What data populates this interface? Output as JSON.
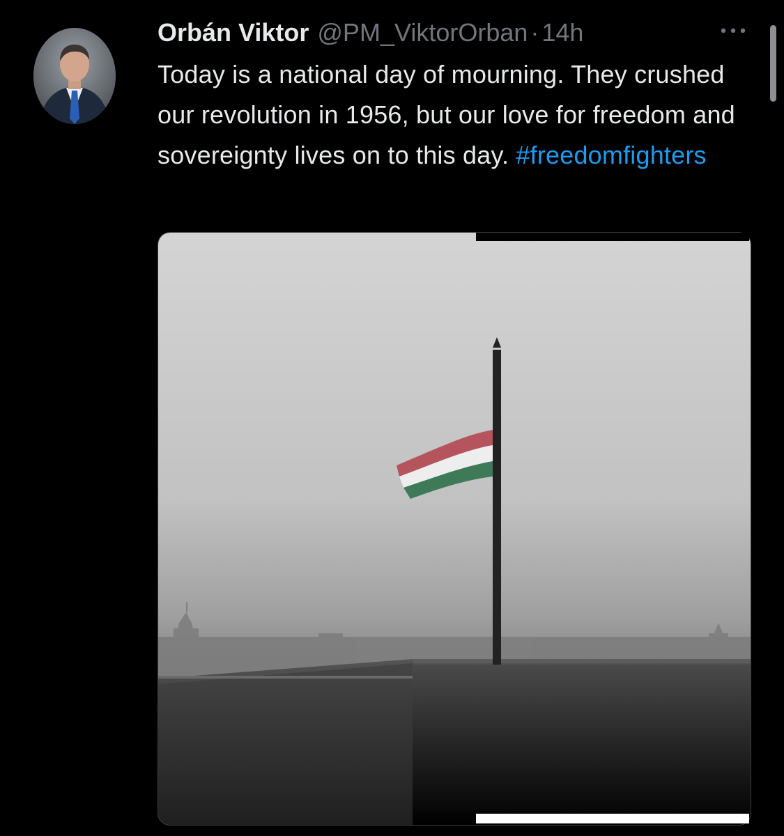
{
  "tweet": {
    "author": {
      "display_name": "Orbán Viktor",
      "handle": "@PM_ViktorOrban",
      "avatar_icon": "profile-photo"
    },
    "separator": "·",
    "timestamp": "14h",
    "text_body": "Today is a national day of mourning. They crushed our revolution in 1956, but our love for freedom and sovereignty lives on to this day. ",
    "hashtag": "#freedomfighters",
    "more_icon": "ellipsis-icon",
    "media": {
      "kind": "photo",
      "icon": "half-mast-flag-photo"
    }
  },
  "colors": {
    "background": "#000000",
    "text_primary": "#e7e9ea",
    "text_secondary": "#71767b",
    "link": "#1d9bf0",
    "flag_red": "#b5545c",
    "flag_white": "#eeeeee",
    "flag_green": "#3f7a58"
  }
}
